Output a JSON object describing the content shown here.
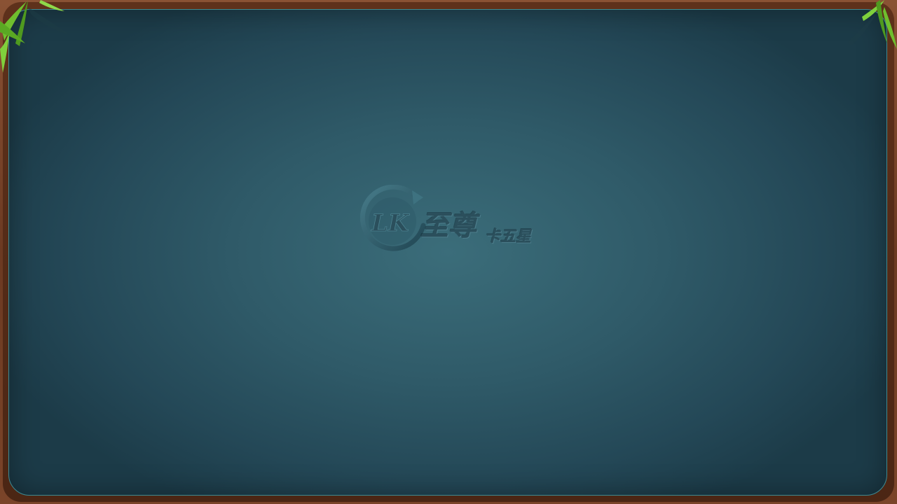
{
  "logo": {
    "emblem_text": "LK",
    "title": "至尊",
    "subtitle": "卡五星"
  },
  "colors": {
    "felt_center": "#3b6d7a",
    "felt_edge": "#1c3b48",
    "wood_frame": "#7a4429",
    "felt_border": "#3d8a92",
    "bamboo_leaf": "#7fc83a"
  },
  "decorations": {
    "left_corner": "bamboo-leaves-icon",
    "right_corner": "bamboo-leaves-icon"
  }
}
